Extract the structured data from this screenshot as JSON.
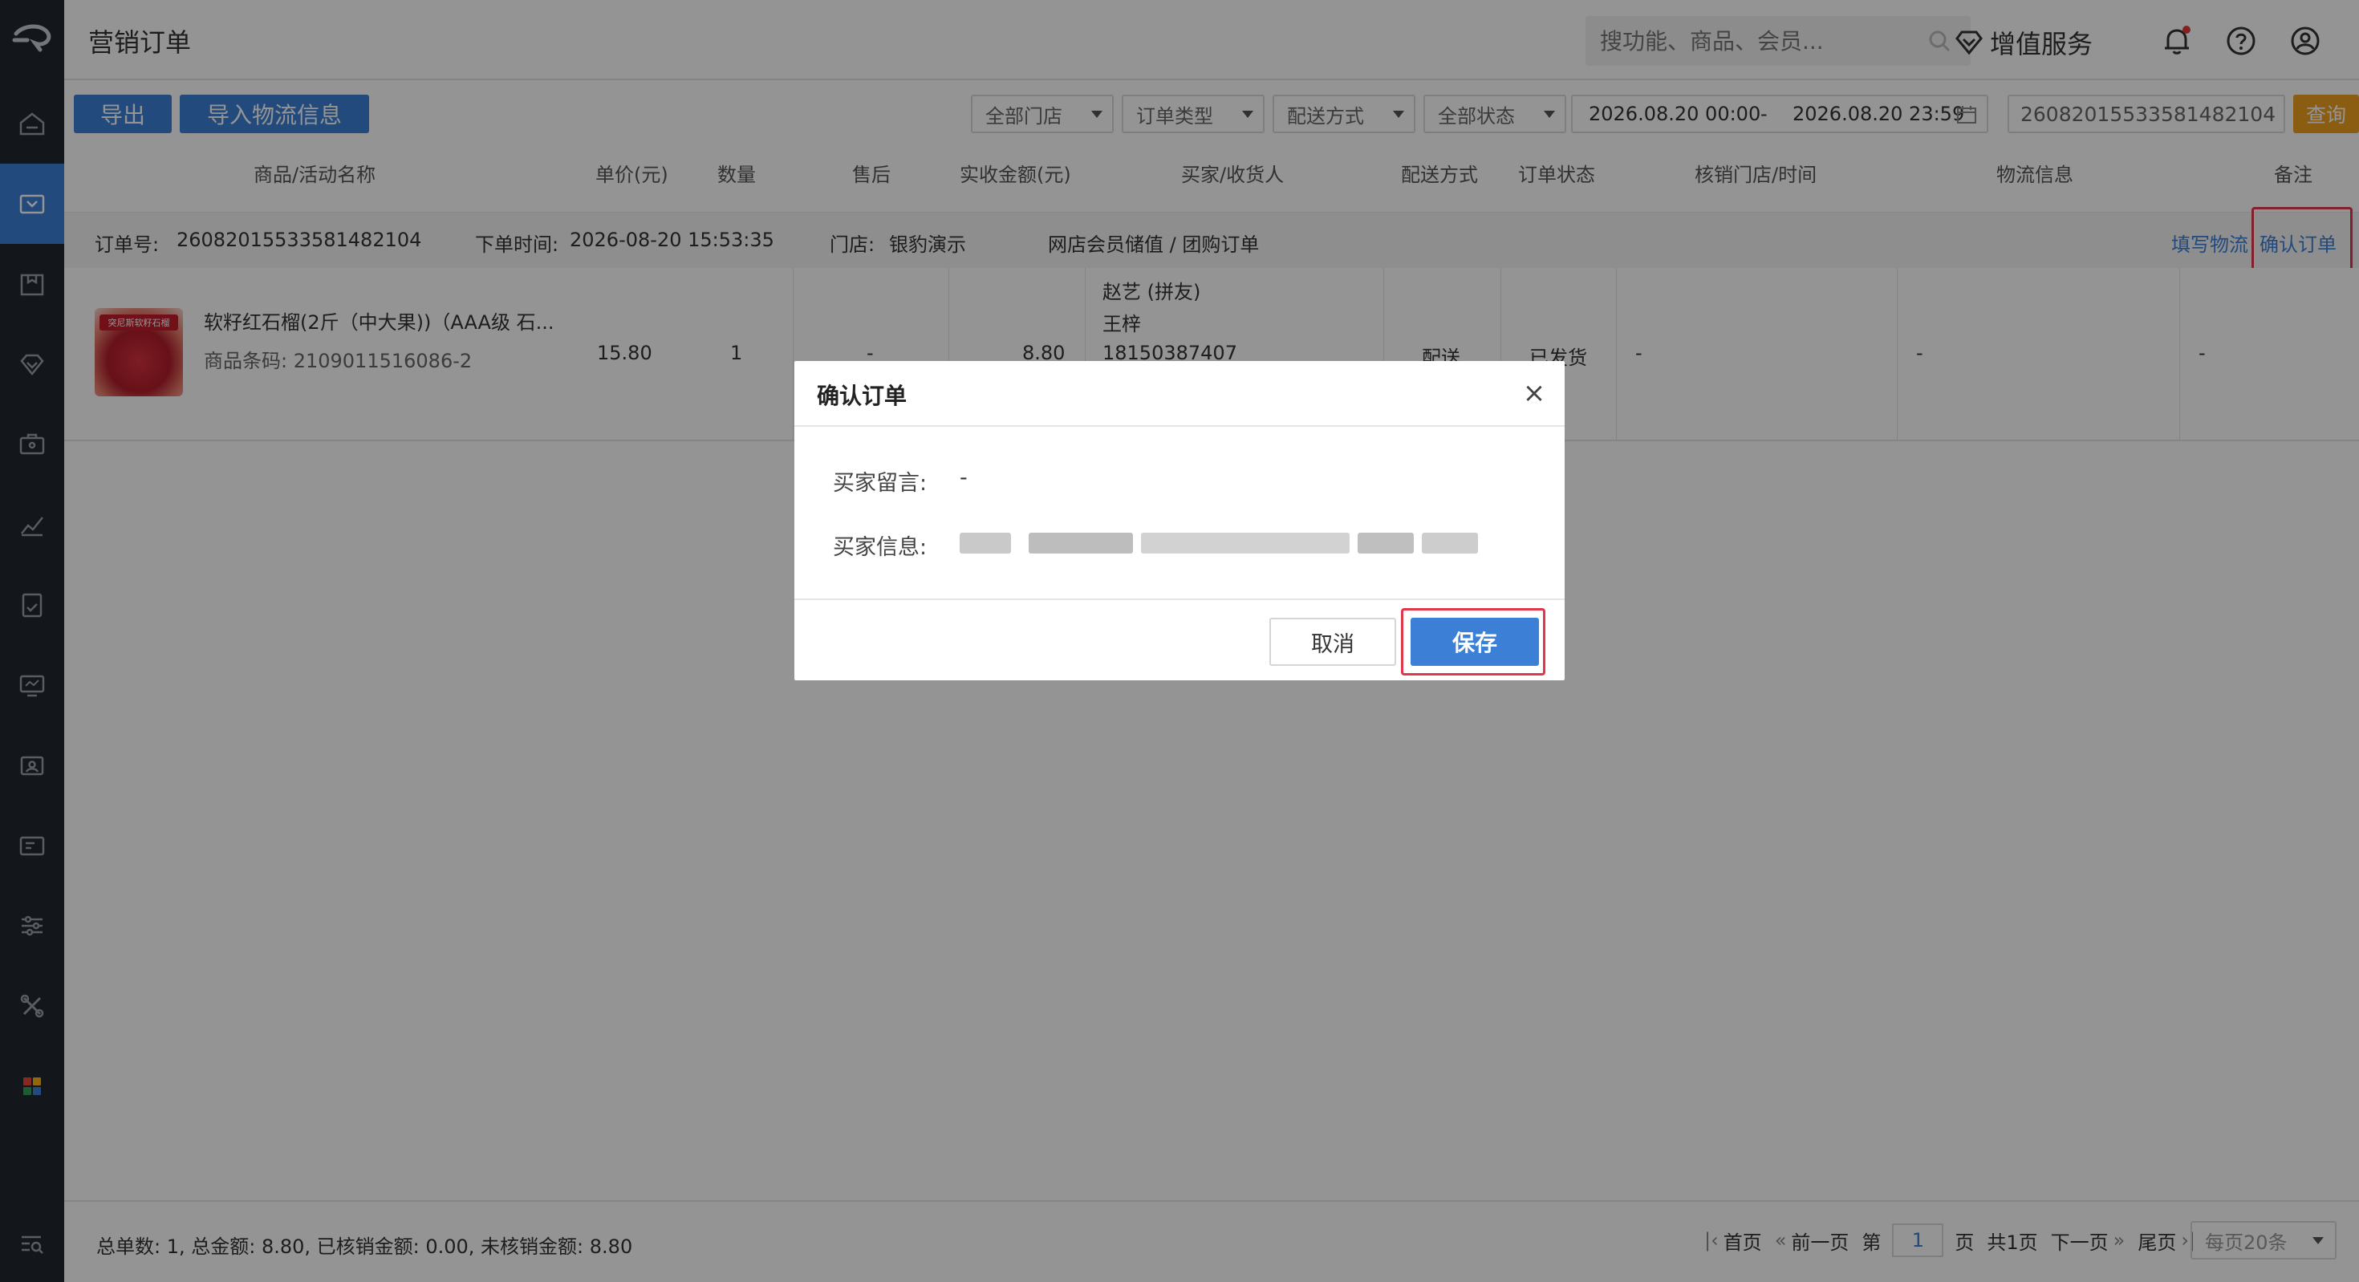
{
  "header": {
    "title": "营销订单",
    "search_placeholder": "搜功能、商品、会员...",
    "value_added": "增值服务"
  },
  "toolbar": {
    "export": "导出",
    "import_logistics": "导入物流信息",
    "filters": [
      "全部门店",
      "订单类型",
      "配送方式",
      "全部状态"
    ],
    "date_start": "2026.08.20 00:00",
    "date_sep": "-",
    "date_end": "2026.08.20 23:59",
    "order_no_value": "26082015533581482104",
    "query": "查询"
  },
  "table": {
    "columns": [
      "商品/活动名称",
      "单价(元)",
      "数量",
      "售后",
      "实收金额(元)",
      "买家/收货人",
      "配送方式",
      "订单状态",
      "核销门店/时间",
      "物流信息",
      "备注"
    ]
  },
  "order": {
    "order_no_label": "订单号:",
    "order_no": "26082015533581482104",
    "time_label": "下单时间:",
    "time": "2026-08-20 15:53:35",
    "store_label": "门店:",
    "store": "银豹演示",
    "type": "网店会员储值 / 团购订单",
    "fill_logistics": "填写物流",
    "confirm_order": "确认订单",
    "product_name": "软籽红石榴(2斤（中大果))（AAA级 石...",
    "product_code": "商品条码: 2109011516086-2",
    "product_tag": "突尼斯软籽石榴",
    "price": "15.80",
    "qty": "1",
    "after_sale": "-",
    "amount": "8.80",
    "buyer": "赵艺 (拼友)",
    "receiver": "王梓",
    "phone": "18150387407",
    "delivery": "配送",
    "status": "已发货",
    "verify": "-",
    "logistics": "-",
    "remark": "-"
  },
  "footer": {
    "summary": "总单数: 1, 总金额: 8.80, 已核销金额: 0.00, 未核销金额: 8.80",
    "first": "首页",
    "prev": "前一页",
    "page_prefix": "第",
    "page": "1",
    "page_suffix": "页",
    "total_pages": "共1页",
    "next": "下一页",
    "last": "尾页",
    "per_page": "每页20条"
  },
  "modal": {
    "title": "确认订单",
    "close": "×",
    "msg_label": "买家留言:",
    "msg_value": "-",
    "info_label": "买家信息:",
    "cancel": "取消",
    "save": "保存"
  },
  "colors": {
    "primary": "#3b80d6",
    "query": "#f0a020",
    "sidebar": "#22272e",
    "highlight": "#e0384b"
  }
}
